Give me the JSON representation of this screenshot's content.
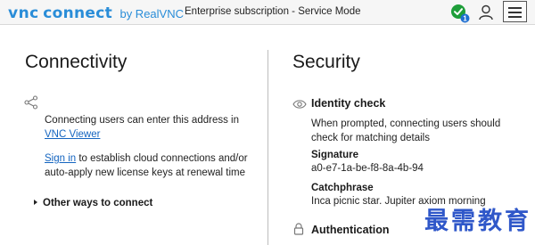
{
  "header": {
    "logo": {
      "vnc": "vnc",
      "connect": "connect",
      "by": "by RealVNC"
    },
    "subscription": "Enterprise subscription - Service Mode",
    "status_badge_count": "1"
  },
  "connectivity": {
    "title": "Connectivity",
    "address_text": "Connecting users can enter this address in ",
    "vnc_viewer_link": "VNC Viewer",
    "sign_in_link": "Sign in",
    "sign_in_text": " to establish cloud connections and/or auto-apply new license keys at renewal time",
    "other_ways": "Other ways to connect"
  },
  "security": {
    "title": "Security",
    "identity_heading": "Identity check",
    "identity_text": "When prompted, connecting users should check for matching details",
    "signature_label": "Signature",
    "signature_value": "a0-e7-1a-be-f8-8a-4b-94",
    "catchphrase_label": "Catchphrase",
    "catchphrase_value": "Inca picnic star. Jupiter axiom morning",
    "authentication_heading": "Authentication"
  },
  "watermark": "最需教育",
  "colors": {
    "brand": "#2a8dd8",
    "link": "#1565c0",
    "status_ok": "#1e9e3a",
    "badge": "#1f6fd1",
    "watermark": "#2f57c9"
  }
}
